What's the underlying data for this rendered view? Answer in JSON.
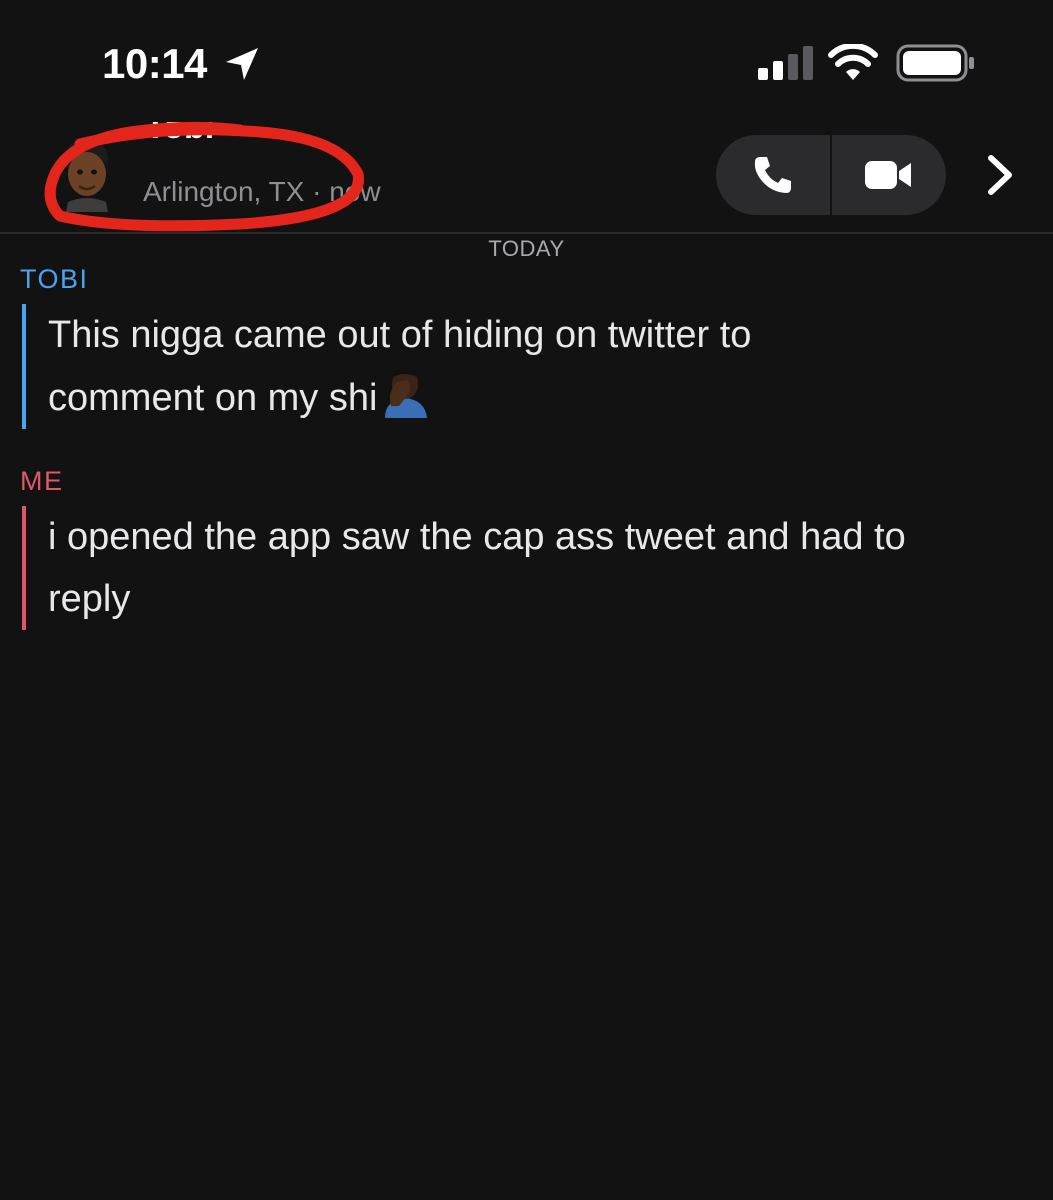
{
  "status_bar": {
    "time": "10:14",
    "icons": [
      "location-arrow-icon",
      "cellular-signal-icon",
      "wifi-icon",
      "battery-icon"
    ]
  },
  "header": {
    "contact_name": "Tobi",
    "subtitle": "Arlington, TX · now",
    "buttons": [
      "phone-icon",
      "video-camera-icon",
      "chevron-right-icon"
    ]
  },
  "conversation": {
    "date_label": "TODAY",
    "messages": [
      {
        "sender": "TOBI",
        "lines": [
          "This nigga came out of hiding on twitter to",
          "comment on my shi"
        ],
        "emoji": "man-facepalming-emoji"
      },
      {
        "sender": "ME",
        "lines": [
          "i opened the app saw the cap ass tweet and had to",
          "reply"
        ]
      }
    ]
  },
  "colors": {
    "background": "#121213",
    "tobi_accent": "#4ba3f0",
    "me_accent": "#e05767",
    "annotation": "#e3251c"
  }
}
